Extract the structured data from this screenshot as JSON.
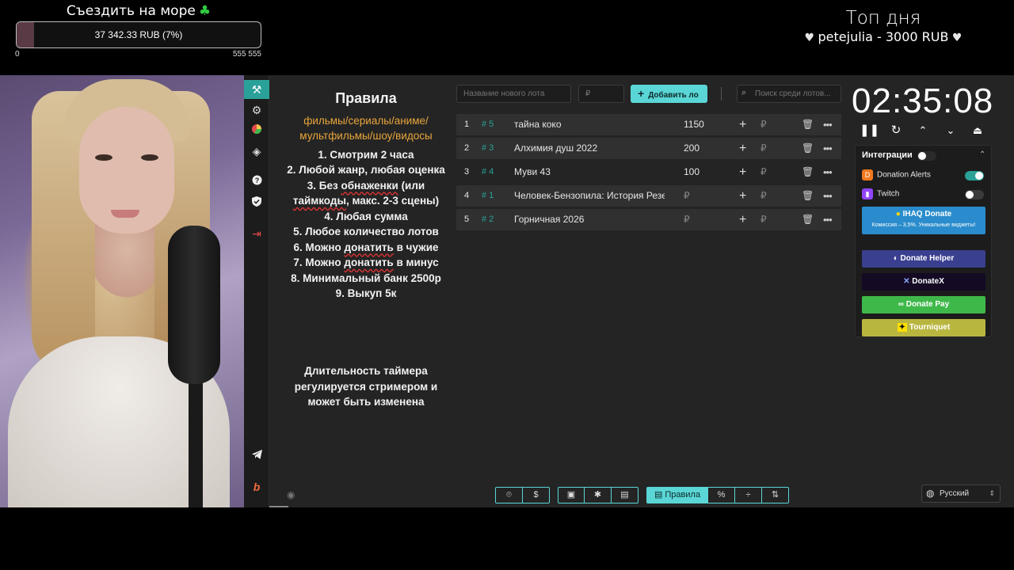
{
  "overlay": {
    "goal_title": "Съездить на море",
    "goal_icon": "clover-icon",
    "goal_text": "37 342.33 RUB (7%)",
    "goal_progress": 0.07,
    "goal_min": "0",
    "goal_max": "555 555",
    "top_day_title": "Топ дня",
    "top_day_entry": "petejulia - 3000 RUB"
  },
  "sidebar": {
    "icons": [
      "auction-icon",
      "gear-icon",
      "pie-chart-icon",
      "layers-icon",
      "help-icon",
      "shield-icon",
      "logout-icon",
      "telegram-icon",
      "boosty-icon"
    ]
  },
  "rules": {
    "title": "Правила",
    "categories": "фильмы/сериалы/аниме/ мультфильмы/шоу/видосы",
    "r1": "1. Смотрим 2 часа",
    "r2": "2. Любой жанр, любая оценка",
    "r3a": "3. Без ",
    "r3b": "обнаженки",
    "r3c": " (или ",
    "r3d": "таймкоды",
    "r3e": ", макс. 2-3 сцены)",
    "r4": "4. Любая сумма",
    "r5": "5. Любое количество лотов",
    "r6a": "6. Можно ",
    "r6b": "донатить",
    "r6c": " в чужие",
    "r7a": "7. Можно ",
    "r7b": "донатить",
    "r7c": " в минус",
    "r8": "8. Минимальный банк 2500р",
    "r9": "9. Выкуп 5к",
    "note": "Длительность таймера регулируется стримером и может быть изменена"
  },
  "toolbar": {
    "new_lot_placeholder": "Название нового лота",
    "price_placeholder": "₽",
    "add_label": "Добавить ло",
    "search_placeholder": "Поиск среди лотов..."
  },
  "lots": [
    {
      "num": "1",
      "id": "# 5",
      "name": "тайна коко",
      "amount": "1150"
    },
    {
      "num": "2",
      "id": "# 3",
      "name": "Алхимия душ 2022",
      "amount": "200"
    },
    {
      "num": "3",
      "id": "# 4",
      "name": "Муви 43",
      "amount": "100"
    },
    {
      "num": "4",
      "id": "# 1",
      "name": "Человек-Бензопила: История Резе",
      "amount": "₽"
    },
    {
      "num": "5",
      "id": "# 2",
      "name": "Горничная 2026",
      "amount": "₽"
    }
  ],
  "lot_currency": "₽",
  "timer": {
    "value": "02:35:08"
  },
  "integrations": {
    "title": "Интеграции",
    "services": [
      {
        "name": "Donation Alerts",
        "enabled": true
      },
      {
        "name": "Twitch",
        "enabled": false
      }
    ],
    "ihaq_label": "IHAQ Donate",
    "ihaq_sub": "Комиссия – 3,5%. Уникальные виджеты!",
    "buttons": [
      {
        "label": "Donate Helper",
        "color": "#3a3f8f"
      },
      {
        "label": "DonateX",
        "color": "#140a24"
      },
      {
        "label": "Donate Pay",
        "color": "#3fb84a"
      },
      {
        "label": "Tourniquet",
        "color": "#b9b640"
      }
    ]
  },
  "bottom": {
    "rules_tab": "Правила",
    "language": "Русский"
  },
  "colors": {
    "accent": "#5ad6d6",
    "id_color": "#2aa198",
    "rules_categories": "#e9a63b"
  }
}
